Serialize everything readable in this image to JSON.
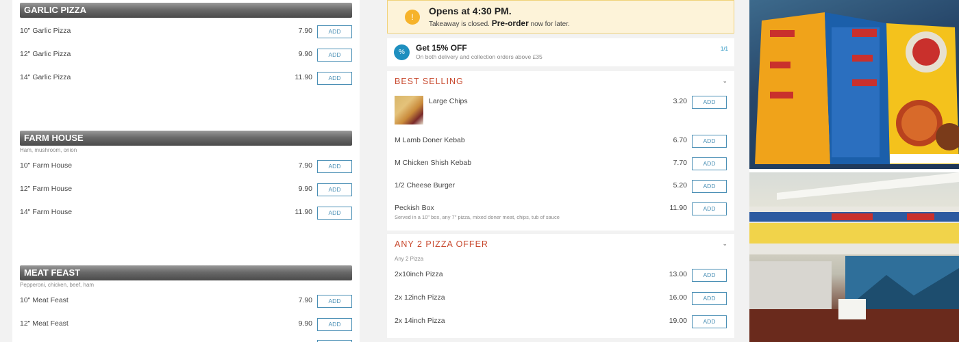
{
  "left_menu": {
    "categories": [
      {
        "title": "GARLIC PIZZA",
        "subtitle": "",
        "items": [
          {
            "name": "10\" Garlic Pizza",
            "price": "7.90",
            "button": "ADD"
          },
          {
            "name": "12\" Garlic Pizza",
            "price": "9.90",
            "button": "ADD"
          },
          {
            "name": "14\" Garlic Pizza",
            "price": "11.90",
            "button": "ADD"
          }
        ]
      },
      {
        "title": "FARM HOUSE",
        "subtitle": "Ham, mushroom, onion",
        "items": [
          {
            "name": "10\" Farm House",
            "price": "7.90",
            "button": "ADD"
          },
          {
            "name": "12\" Farm House",
            "price": "9.90",
            "button": "ADD"
          },
          {
            "name": "14\" Farm House",
            "price": "11.90",
            "button": "ADD"
          }
        ]
      },
      {
        "title": "MEAT FEAST",
        "subtitle": "Pepperoni, chicken, beef, ham",
        "items": [
          {
            "name": "10\" Meat Feast",
            "price": "7.90",
            "button": "ADD"
          },
          {
            "name": "12\" Meat Feast",
            "price": "9.90",
            "button": "ADD"
          }
        ]
      }
    ]
  },
  "notice": {
    "title": "Opens at 4:30 PM.",
    "text_before": "Takeaway is closed.",
    "highlight": "Pre-order",
    "text_after": "now for later.",
    "icon": "exclamation-icon"
  },
  "offer": {
    "title": "Get 15% OFF",
    "subtitle": "On both delivery and collection orders above £35",
    "count": "1/1",
    "icon": "percent-badge-icon"
  },
  "best_selling": {
    "title": "BEST SELLING",
    "items": [
      {
        "name": "Large Chips",
        "price": "3.20",
        "button": "ADD",
        "desc": ""
      },
      {
        "name": "M Lamb Doner Kebab",
        "price": "6.70",
        "button": "ADD",
        "desc": ""
      },
      {
        "name": "M Chicken Shish Kebab",
        "price": "7.70",
        "button": "ADD",
        "desc": ""
      },
      {
        "name": "1/2 Cheese Burger",
        "price": "5.20",
        "button": "ADD",
        "desc": ""
      },
      {
        "name": "Peckish Box",
        "price": "11.90",
        "button": "ADD",
        "desc": "Served in a 10\" box, any 7\" pizza, mixed doner meat, chips, tub of sauce"
      }
    ]
  },
  "pizza_offer": {
    "title": "ANY 2 PIZZA OFFER",
    "subtitle": "Any 2 Pizza",
    "items": [
      {
        "name": "2x10inch Pizza",
        "price": "13.00",
        "button": "ADD"
      },
      {
        "name": "2x 12inch Pizza",
        "price": "16.00",
        "button": "ADD"
      },
      {
        "name": "2x 14inch Pizza",
        "price": "19.00",
        "button": "ADD"
      }
    ]
  },
  "colors": {
    "accent": "#4a8fb5",
    "section_title": "#c8492e",
    "notice_bg": "#fdf3d9",
    "notice_icon": "#f6b32b",
    "offer_icon": "#1e8fbf"
  }
}
